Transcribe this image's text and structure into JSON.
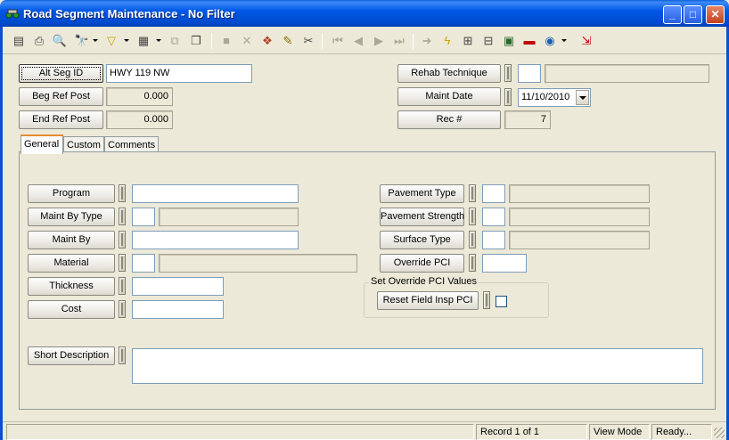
{
  "window": {
    "title": "Road Segment Maintenance - No Filter",
    "min_glyph": "_",
    "max_glyph": "□",
    "close_glyph": "✕"
  },
  "toolbar": {
    "icons": [
      {
        "name": "new-icon",
        "glyph": "▤",
        "enabled": false
      },
      {
        "name": "print-icon",
        "glyph": "⎙",
        "enabled": true
      },
      {
        "name": "print-preview-icon",
        "glyph": "🔍",
        "enabled": true
      },
      {
        "name": "find-icon",
        "glyph": "🔭",
        "enabled": true
      },
      {
        "name": "filter-icon",
        "glyph": "▽",
        "enabled": true
      },
      {
        "name": "report-icon",
        "glyph": "▦",
        "enabled": true
      },
      {
        "name": "copy-record-icon",
        "glyph": "⧉",
        "enabled": false
      },
      {
        "name": "duplicate-icon",
        "glyph": "❐",
        "enabled": true
      },
      {
        "name": "save-icon",
        "glyph": "■",
        "enabled": false
      },
      {
        "name": "delete-icon",
        "glyph": "✕",
        "enabled": false
      },
      {
        "name": "attachments-icon",
        "glyph": "❖",
        "enabled": true
      },
      {
        "name": "edit-icon",
        "glyph": "✎",
        "enabled": true
      },
      {
        "name": "cut-icon",
        "glyph": "✂",
        "enabled": true
      },
      {
        "name": "first-record-icon",
        "glyph": "⏮",
        "enabled": false
      },
      {
        "name": "prev-record-icon",
        "glyph": "◀",
        "enabled": false
      },
      {
        "name": "next-record-icon",
        "glyph": "▶",
        "enabled": false
      },
      {
        "name": "last-record-icon",
        "glyph": "⏭",
        "enabled": false
      },
      {
        "name": "go-to-icon",
        "glyph": "➜",
        "enabled": true
      },
      {
        "name": "lightning-icon",
        "glyph": "ϟ",
        "enabled": true
      },
      {
        "name": "related-icon",
        "glyph": "⊞",
        "enabled": true
      },
      {
        "name": "hierarchy-icon",
        "glyph": "⊟",
        "enabled": true
      },
      {
        "name": "map-icon",
        "glyph": "▣",
        "enabled": true
      },
      {
        "name": "vehicle-icon",
        "glyph": "▬",
        "enabled": true
      },
      {
        "name": "globe-icon",
        "glyph": "◉",
        "enabled": true
      },
      {
        "name": "exit-icon",
        "glyph": "⇲",
        "enabled": true
      }
    ]
  },
  "header": {
    "alt_seg_id_label": "Alt Seg ID",
    "alt_seg_id_value": "HWY 119 NW",
    "beg_ref_post_label": "Beg Ref Post",
    "beg_ref_post_value": "0.000",
    "end_ref_post_label": "End Ref Post",
    "end_ref_post_value": "0.000",
    "rehab_technique_label": "Rehab Technique",
    "rehab_technique_code": "",
    "rehab_technique_desc": "",
    "maint_date_label": "Maint Date",
    "maint_date_value": "11/10/2010",
    "rec_label": "Rec #",
    "rec_value": "7"
  },
  "tabs": [
    {
      "label": "General",
      "active": true
    },
    {
      "label": "Custom",
      "active": false
    },
    {
      "label": "Comments",
      "active": false
    }
  ],
  "general": {
    "program_label": "Program",
    "program_value": "",
    "maint_by_type_label": "Maint By Type",
    "maint_by_type_code": "",
    "maint_by_type_desc": "",
    "maint_by_label": "Maint By",
    "maint_by_value": "",
    "material_label": "Material",
    "material_code": "",
    "material_desc": "",
    "thickness_label": "Thickness",
    "thickness_value": "",
    "cost_label": "Cost",
    "cost_value": "",
    "pavement_type_label": "Pavement Type",
    "pavement_type_code": "",
    "pavement_type_desc": "",
    "pavement_strength_label": "Pavement Strength",
    "pavement_strength_code": "",
    "pavement_strength_desc": "",
    "surface_type_label": "Surface Type",
    "surface_type_code": "",
    "surface_type_desc": "",
    "override_pci_label": "Override PCI",
    "override_pci_value": "",
    "set_override_group_label": "Set Override PCI Values",
    "reset_field_insp_label": "Reset Field Insp PCI",
    "reset_field_insp_checked": false,
    "short_description_label": "Short Description",
    "short_description_value": ""
  },
  "statusbar": {
    "record": "Record 1 of 1",
    "mode": "View Mode",
    "status": "Ready..."
  },
  "colors": {
    "titlebar": "#0058e6",
    "face": "#ece9d8",
    "tab_highlight": "#e68b2c",
    "close_button": "#c1421c"
  }
}
